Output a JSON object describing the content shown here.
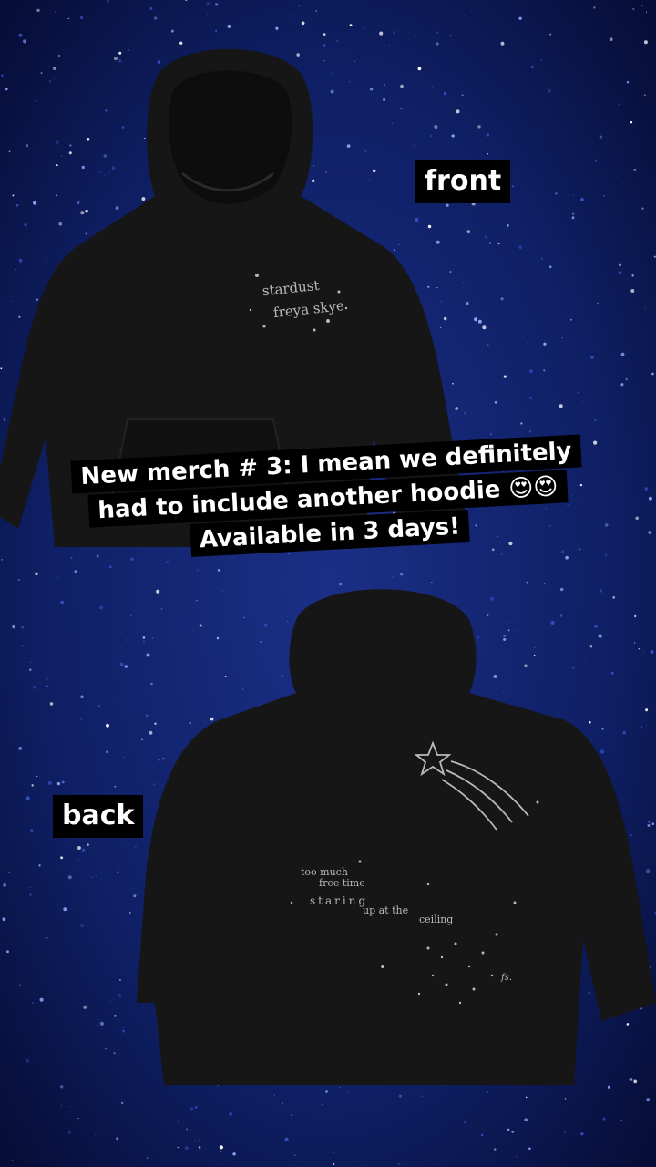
{
  "story": {
    "front_label": "front",
    "back_label": "back",
    "caption_lines": [
      "New merch # 3: I mean we definitely",
      "had to include another hoodie 😍😍",
      "Available in 3 days!"
    ]
  },
  "front_print": {
    "line1": "stardust",
    "line2": "freya skye"
  },
  "back_print": {
    "line1": "too much",
    "line2": "free time",
    "line3": "staring",
    "line4": "up at the",
    "line5": "ceiling",
    "signature": "fs."
  },
  "colors": {
    "background": "#0c1a55",
    "hoodie": "#161616",
    "label_bg": "#000000",
    "label_text": "#ffffff",
    "print": "#b9b9b9"
  }
}
